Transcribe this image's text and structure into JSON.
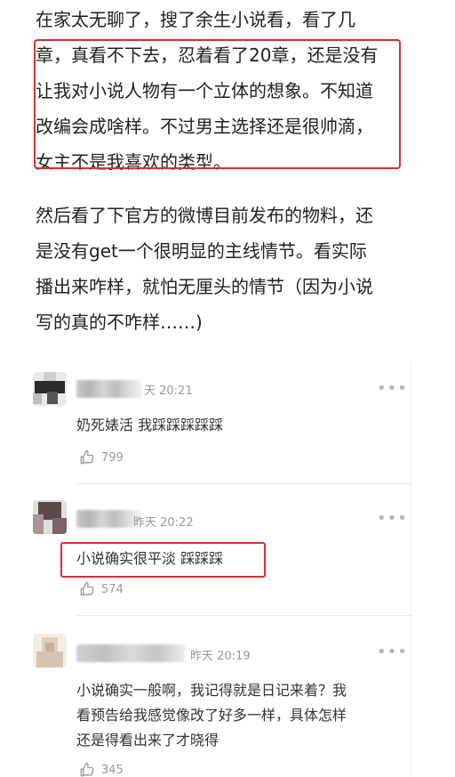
{
  "article": {
    "paragraph1": [
      "在家太无聊了，搜了余生小说看，看了几",
      "章，真看不下去，忍着看了20章，还是没有",
      "让我对小说人物有一个立体的想象。不知道",
      "改编会成啥样。不过男主选择还是很帅滴，",
      "女主不是我喜欢的类型。"
    ],
    "paragraph2": [
      "然后看了下官方的微博目前发布的物料，还",
      "是没有get一个很明显的主线情节。看实际",
      "播出来咋样，就怕无厘头的情节（因为小说",
      "写的真的不咋样……)"
    ]
  },
  "comments": [
    {
      "time": "天 20:21",
      "text_lines": [
        "奶死婊活 我踩踩踩踩踩"
      ],
      "likes": "799",
      "more_icon": "more-dots-icon"
    },
    {
      "time": "昨天 20:22",
      "text_lines": [
        "小说确实很平淡 踩踩踩"
      ],
      "likes": "574",
      "more_icon": "more-dots-icon"
    },
    {
      "time": "昨天 20:19",
      "text_lines": [
        "小说确实一般啊，我记得就是日记来着？我",
        "看预告给我感觉像改了好多一样，具体怎样",
        "还是得看出来了才晓得"
      ],
      "likes": "345",
      "more_icon": "more-dots-icon"
    }
  ],
  "colors": {
    "highlight_border": "#d0332f",
    "meta_text": "#9a9a9a"
  }
}
